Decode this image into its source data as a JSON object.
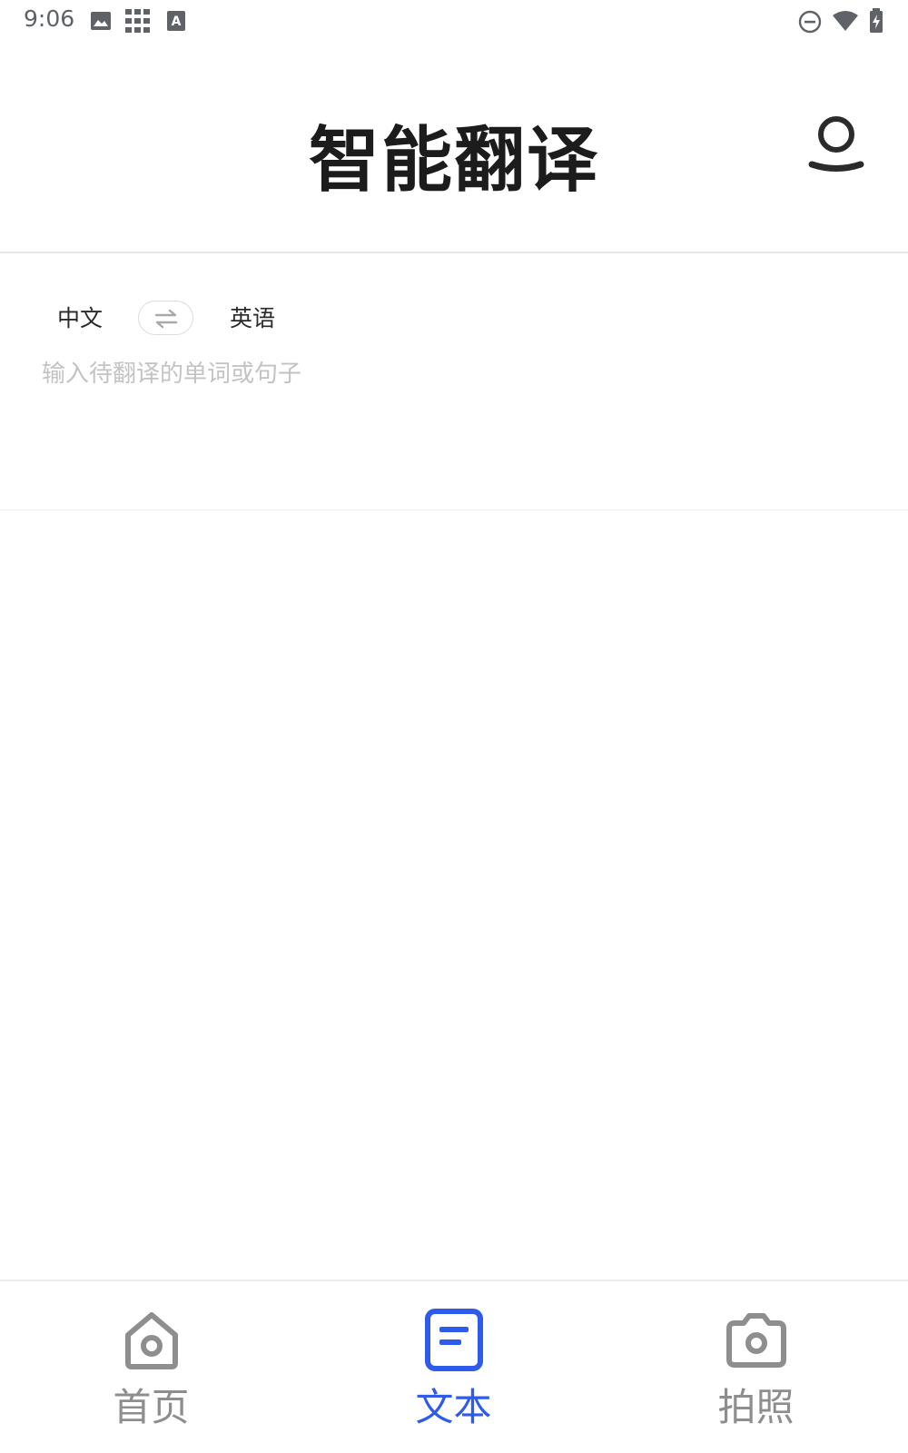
{
  "status_bar": {
    "time": "9:06",
    "left_icons": [
      "image-icon",
      "grid-apps-icon",
      "font-a-icon"
    ],
    "right_icons": [
      "do-not-disturb-icon",
      "wifi-icon",
      "battery-charging-icon"
    ]
  },
  "header": {
    "title": "智能翻译",
    "profile_icon": "user-icon"
  },
  "translator": {
    "source_language": "中文",
    "target_language": "英语",
    "swap_icon": "swap-arrows-icon",
    "input_value": "",
    "input_placeholder": "输入待翻译的单词或句子"
  },
  "bottom_nav": {
    "items": [
      {
        "label": "首页",
        "icon": "home-icon",
        "active": false
      },
      {
        "label": "文本",
        "icon": "document-icon",
        "active": true
      },
      {
        "label": "拍照",
        "icon": "camera-icon",
        "active": false
      }
    ]
  },
  "colors": {
    "accent": "#2f5bea",
    "inactive": "#8e8e8e",
    "title": "#1c1c1c",
    "placeholder": "#c3c3c3"
  }
}
